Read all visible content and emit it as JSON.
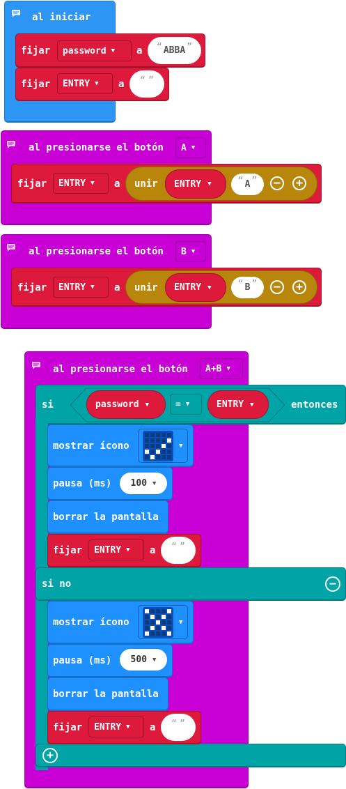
{
  "on_start": {
    "title": "al iniciar",
    "rows": [
      {
        "set": "fijar",
        "variable": "password",
        "to": "a",
        "value": "ABBA"
      },
      {
        "set": "fijar",
        "variable": "ENTRY",
        "to": "a",
        "value": ""
      }
    ]
  },
  "button_a": {
    "title": "al presionarse el botón",
    "button": "A",
    "set": "fijar",
    "variable": "ENTRY",
    "to": "a",
    "join": "unir",
    "join_var": "ENTRY",
    "join_text": "A"
  },
  "button_b": {
    "title": "al presionarse el botón",
    "button": "B",
    "set": "fijar",
    "variable": "ENTRY",
    "to": "a",
    "join": "unir",
    "join_var": "ENTRY",
    "join_text": "B"
  },
  "button_ab": {
    "title": "al presionarse el botón",
    "button": "A+B",
    "if_label": "si",
    "left_var": "password",
    "operator": "=",
    "right_var": "ENTRY",
    "then_label": "entonces",
    "else_label": "si no",
    "then": {
      "show_icon": "mostrar ícono",
      "icon_name": "yes-icon",
      "icon_pixels": [
        0,
        0,
        0,
        0,
        0,
        0,
        0,
        0,
        0,
        1,
        0,
        0,
        0,
        1,
        0,
        1,
        0,
        1,
        0,
        0,
        0,
        1,
        0,
        0,
        0
      ],
      "pause": "pausa (ms)",
      "pause_value": "100",
      "clear": "borrar la pantalla",
      "set": "fijar",
      "variable": "ENTRY",
      "to": "a",
      "value": ""
    },
    "else": {
      "show_icon": "mostrar ícono",
      "icon_name": "no-icon",
      "icon_pixels": [
        1,
        0,
        0,
        0,
        1,
        0,
        1,
        0,
        1,
        0,
        0,
        0,
        1,
        0,
        0,
        0,
        1,
        0,
        1,
        0,
        1,
        0,
        0,
        0,
        1
      ],
      "pause": "pausa (ms)",
      "pause_value": "500",
      "clear": "borrar la pantalla",
      "set": "fijar",
      "variable": "ENTRY",
      "to": "a",
      "value": ""
    }
  },
  "icons": {
    "dropdown": "▼",
    "minus": "−",
    "plus": "+",
    "quote_open": "“",
    "quote_close": "”"
  },
  "colors": {
    "on_start": "#2D96F5",
    "event": "#C800D6",
    "variables": "#DD1A3C",
    "logic": "#00A4A6",
    "basic": "#1E90FF",
    "text": "#B8860B"
  }
}
